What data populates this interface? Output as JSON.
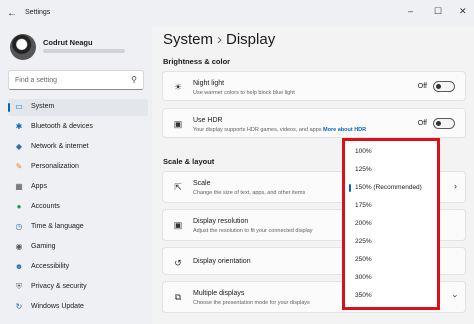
{
  "window": {
    "title": "Settings",
    "back_icon": "arrow-left-icon"
  },
  "user": {
    "name": "Codrut Neagu"
  },
  "search": {
    "placeholder": "Find a setting"
  },
  "sidebar": {
    "items": [
      {
        "label": "System",
        "icon": "monitor-icon",
        "active": true
      },
      {
        "label": "Bluetooth & devices",
        "icon": "bluetooth-icon"
      },
      {
        "label": "Network & internet",
        "icon": "wifi-icon"
      },
      {
        "label": "Personalization",
        "icon": "brush-icon"
      },
      {
        "label": "Apps",
        "icon": "apps-icon"
      },
      {
        "label": "Accounts",
        "icon": "person-icon"
      },
      {
        "label": "Time & language",
        "icon": "globe-clock-icon"
      },
      {
        "label": "Gaming",
        "icon": "gamepad-icon"
      },
      {
        "label": "Accessibility",
        "icon": "accessibility-icon"
      },
      {
        "label": "Privacy & security",
        "icon": "shield-icon"
      },
      {
        "label": "Windows Update",
        "icon": "refresh-icon"
      }
    ]
  },
  "main": {
    "breadcrumb": {
      "parent": "System",
      "current": "Display"
    },
    "brightness_section": "Brightness & color",
    "scale_section": "Scale & layout",
    "night_light": {
      "title": "Night light",
      "desc": "Use warmer colors to help block blue light",
      "state": "Off"
    },
    "hdr": {
      "title": "Use HDR",
      "desc": "Your display supports HDR games, videos, and apps",
      "link": "More about HDR",
      "state": "Off"
    },
    "scale": {
      "title": "Scale",
      "desc": "Change the size of text, apps, and other items"
    },
    "resolution": {
      "title": "Display resolution",
      "desc": "Adjust the resolution to fit your connected display"
    },
    "orientation": {
      "title": "Display orientation"
    },
    "multiple": {
      "title": "Multiple displays",
      "desc": "Choose the presentation mode for your displays"
    }
  },
  "scale_dropdown": {
    "options": [
      "100%",
      "125%",
      "150% (Recommended)",
      "175%",
      "200%",
      "225%",
      "250%",
      "300%",
      "350%"
    ],
    "selected": "150% (Recommended)"
  },
  "colors": {
    "accent": "#0067c0",
    "highlight_border": "#d9111a"
  }
}
